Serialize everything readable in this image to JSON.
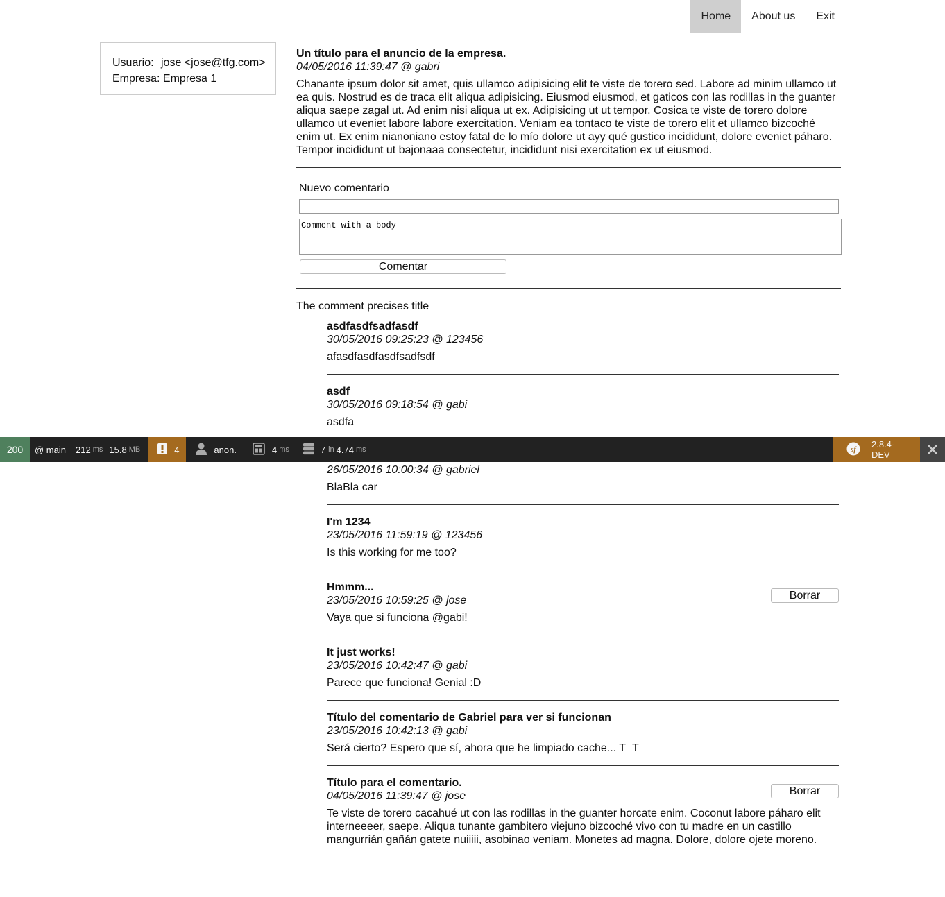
{
  "nav": {
    "items": [
      {
        "label": "Home",
        "active": true
      },
      {
        "label": "About us",
        "active": false
      },
      {
        "label": "Exit",
        "active": false
      }
    ]
  },
  "user": {
    "usuario_label": "Usuario:",
    "usuario_value": "jose <jose@tfg.com>",
    "empresa_label": "Empresa:",
    "empresa_value": "Empresa 1"
  },
  "announcement": {
    "title": "Un título para el anuncio de la empresa.",
    "meta": "04/05/2016 11:39:47 @ gabri",
    "body": "Chanante ipsum dolor sit amet, quis ullamco adipisicing elit te viste de torero sed. Labore ad minim ullamco ut ea quis. Nostrud es de traca elit aliqua adipisicing. Eiusmod eiusmod, et gaticos con las rodillas in the guanter aliqua saepe zagal ut. Ad enim nisi aliqua ut ex. Adipisicing ut ut tempor. Cosica te viste de torero dolore ullamco ut eveniet labore labore exercitation. Veniam ea tontaco te viste de torero elit et ullamco bizcoché enim ut. Ex enim nianoniano estoy fatal de lo mío dolore ut ayy qué gustico incididunt, dolore eveniet páharo. Tempor incididunt ut bajonaaa consectetur, incididunt nisi exercitation ex ut eiusmod."
  },
  "form": {
    "label": "Nuevo comentario",
    "title_value": "",
    "body_value": "Comment with a body",
    "submit_label": "Comentar"
  },
  "comments_section": {
    "title": "The comment precises title",
    "delete_label": "Borrar",
    "items": [
      {
        "title": "asdfasdfsadfasdf",
        "meta": "30/05/2016 09:25:23 @ 123456",
        "body": "afasdfasdfasdfsadfsdf",
        "deletable": false
      },
      {
        "title": "asdf",
        "meta": "30/05/2016 09:18:54 @ gabi",
        "body": "asdfa",
        "deletable": false
      },
      {
        "title": "",
        "meta": "26/05/2016 10:00:34 @ gabriel",
        "body": "BlaBla car",
        "deletable": false
      },
      {
        "title": "I'm 1234",
        "meta": "23/05/2016 11:59:19 @ 123456",
        "body": "Is this working for me too?",
        "deletable": false
      },
      {
        "title": "Hmmm...",
        "meta": "23/05/2016 10:59:25 @ jose",
        "body": "Vaya que si funciona @gabi!",
        "deletable": true
      },
      {
        "title": "It just works!",
        "meta": "23/05/2016 10:42:47 @ gabi",
        "body": "Parece que funciona! Genial :D",
        "deletable": false
      },
      {
        "title": "Título del comentario de Gabriel para ver si funcionan",
        "meta": "23/05/2016 10:42:13 @ gabi",
        "body": "Será cierto? Espero que sí, ahora que he limpiado cache... T_T",
        "deletable": false
      },
      {
        "title": "Título para el comentario.",
        "meta": "04/05/2016 11:39:47 @ jose",
        "body": "Te viste de torero cacahué ut con las rodillas in the guanter horcate enim. Coconut labore páharo elit interneeeer, saepe. Aliqua tunante gambitero viejuno bizcoché vivo con tu madre en un castillo mangurrián gañán gatete nuiiiii, asobinao veniam. Monetes ad magna. Dolore, dolore ojete moreno.",
        "deletable": true
      }
    ]
  },
  "toolbar": {
    "status": "200",
    "route": "@ main",
    "time_value": "212",
    "time_unit": "ms",
    "memory_value": "15.8",
    "memory_unit": "MB",
    "warnings": "4",
    "user": "anon.",
    "render_value": "4",
    "render_unit": "ms",
    "db_queries": "7",
    "db_in": "in",
    "db_time": "4.74",
    "db_unit": "ms",
    "version": "2.8.4-DEV",
    "colors": {
      "status": "#4f805d",
      "warning": "#a46a1f",
      "bar": "#222222"
    }
  }
}
